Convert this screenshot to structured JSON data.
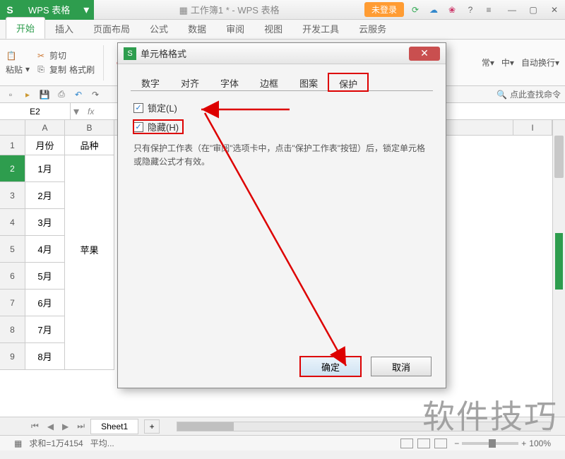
{
  "app": {
    "logo": "S",
    "name": "WPS 表格",
    "doc_title": "工作簿1 * - WPS 表格",
    "login": "未登录"
  },
  "win": {
    "min": "—",
    "max": "▢",
    "close": "✕"
  },
  "menu": {
    "tabs": [
      "开始",
      "插入",
      "页面布局",
      "公式",
      "数据",
      "审阅",
      "视图",
      "开发工具",
      "云服务"
    ]
  },
  "ribbon": {
    "paste": "粘贴",
    "cut": "剪切",
    "copy": "复制",
    "format_brush": "格式刷",
    "right_items": [
      "常",
      "中",
      "自动换行"
    ]
  },
  "qa": {
    "search_hint": "点此查找命令"
  },
  "formula": {
    "name_box": "E2",
    "fx": "fx"
  },
  "cols": [
    "A",
    "B",
    "I"
  ],
  "rows": [
    "1",
    "2",
    "3",
    "4",
    "5",
    "6",
    "7",
    "8",
    "9"
  ],
  "headers": {
    "month": "月份",
    "variety": "品种"
  },
  "data_months": [
    "1月",
    "2月",
    "3月",
    "4月",
    "5月",
    "6月",
    "7月",
    "8月"
  ],
  "variety_value": "苹果",
  "sheet": {
    "name": "Sheet1",
    "add": "+"
  },
  "status": {
    "sum": "求和=1万4154",
    "avg": "平均...",
    "zoom": "100%"
  },
  "dialog": {
    "title": "单元格格式",
    "tabs": [
      "数字",
      "对齐",
      "字体",
      "边框",
      "图案",
      "保护"
    ],
    "lock": "锁定(L)",
    "hide": "隐藏(H)",
    "hint": "只有保护工作表（在\"审阅\"选项卡中，点击\"保护工作表\"按钮）后，锁定单元格或隐藏公式才有效。",
    "ok": "确定",
    "cancel": "取消"
  },
  "watermark": "软件技巧"
}
